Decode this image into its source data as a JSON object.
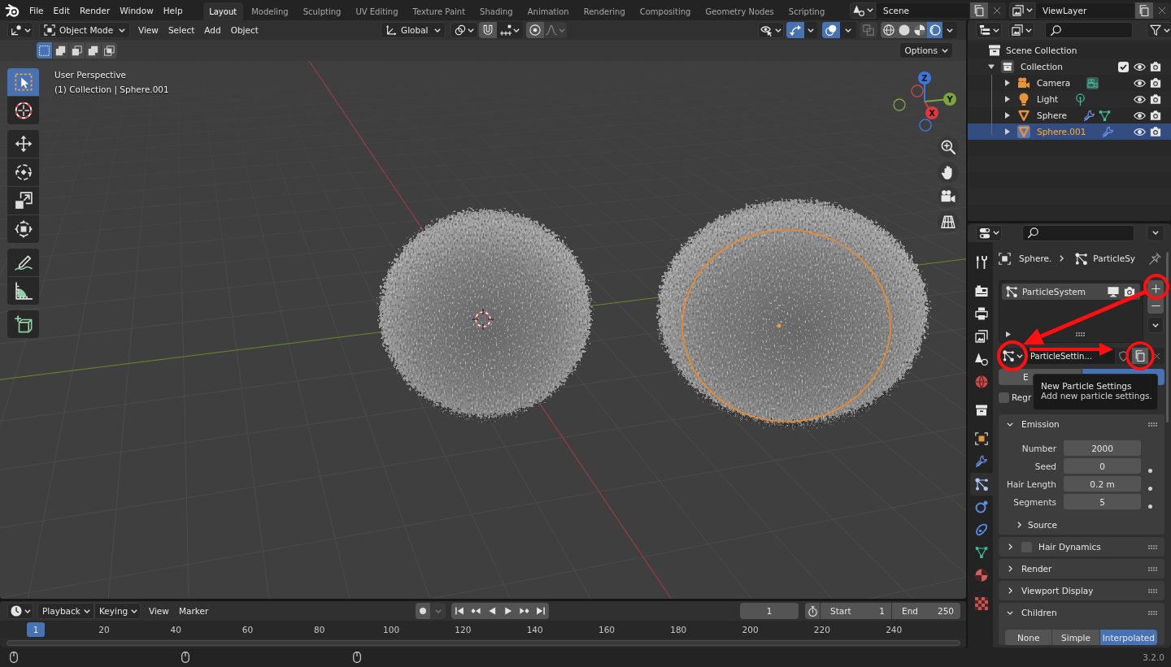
{
  "top_bar": {
    "menus": [
      "File",
      "Edit",
      "Render",
      "Window",
      "Help"
    ],
    "workspaces": [
      {
        "label": "Layout",
        "selected": true
      },
      {
        "label": "Modeling",
        "selected": false
      },
      {
        "label": "Sculpting",
        "selected": false
      },
      {
        "label": "UV Editing",
        "selected": false
      },
      {
        "label": "Texture Paint",
        "selected": false
      },
      {
        "label": "Shading",
        "selected": false
      },
      {
        "label": "Animation",
        "selected": false
      },
      {
        "label": "Rendering",
        "selected": false
      },
      {
        "label": "Compositing",
        "selected": false
      },
      {
        "label": "Geometry Nodes",
        "selected": false
      },
      {
        "label": "Scripting",
        "selected": false
      }
    ],
    "scene": "Scene",
    "view_layer": "ViewLayer"
  },
  "viewport": {
    "header": {
      "mode": "Object Mode",
      "menus": [
        "View",
        "Select",
        "Add",
        "Object"
      ],
      "orientation": "Global",
      "gizmos": {
        "on": true
      },
      "overlays": {
        "on": true
      },
      "xray": {
        "on": false
      },
      "shading": [
        {
          "selected": false
        },
        {
          "selected": false
        },
        {
          "selected": false
        },
        {
          "selected": true
        }
      ]
    },
    "tool_settings": {
      "select_modes": [
        {
          "selected": true
        },
        {
          "selected": false
        },
        {
          "selected": false
        },
        {
          "selected": false
        },
        {
          "selected": false
        }
      ],
      "options": "Options"
    },
    "info": [
      "User Perspective",
      "(1) Collection | Sphere.001"
    ],
    "toolbar": [
      [
        {
          "selected": true
        },
        {
          "selected": false
        }
      ],
      [
        {
          "selected": false
        },
        {
          "selected": false
        },
        {
          "selected": false
        },
        {
          "selected": false
        }
      ],
      [
        {
          "selected": false
        },
        {
          "selected": false
        }
      ],
      [
        {
          "selected": false
        }
      ]
    ],
    "gizmo_axes": [
      "X",
      "Y",
      "Z"
    ]
  },
  "outliner": {
    "tree": [
      {
        "label": "Scene Collection",
        "kind": "scene_collection",
        "selected": false,
        "children": [
          {
            "label": "Collection",
            "kind": "collection",
            "expanded": true,
            "checked": true,
            "selected": false,
            "children": [
              {
                "label": "Camera",
                "kind": "camera",
                "expanded": false,
                "selected": false,
                "extras": [
                  {
                    "kind": "camera_data"
                  }
                ]
              },
              {
                "label": "Light",
                "kind": "light",
                "expanded": false,
                "selected": false,
                "extras": [
                  {
                    "kind": "light_data"
                  }
                ]
              },
              {
                "label": "Sphere",
                "kind": "mesh",
                "expanded": false,
                "selected": false,
                "extras": [
                  {
                    "kind": "modifier"
                  },
                  {
                    "kind": "mesh_data"
                  }
                ]
              },
              {
                "label": "Sphere.001",
                "kind": "mesh",
                "expanded": false,
                "selected": true,
                "extras": [
                  {
                    "kind": "modifier"
                  }
                ]
              }
            ]
          }
        ]
      }
    ]
  },
  "properties": {
    "tabs": [
      [
        {
          "selected": false
        }
      ],
      [
        {
          "selected": false
        },
        {
          "selected": false
        },
        {
          "selected": false
        },
        {
          "selected": false
        },
        {
          "selected": false
        }
      ],
      [
        {
          "selected": false
        }
      ],
      [
        {
          "selected": false
        },
        {
          "selected": false
        },
        {
          "selected": true
        },
        {
          "selected": false
        },
        {
          "selected": false
        },
        {
          "selected": false
        },
        {
          "selected": false
        }
      ],
      [
        {
          "selected": false
        }
      ]
    ],
    "breadcrumb": [
      "Sphere.",
      "ParticleSy"
    ],
    "systems": [
      {
        "name": "ParticleSystem",
        "selected": true
      }
    ],
    "settings": "ParticleSettin...",
    "types": [
      {
        "label": "E",
        "selected": false
      },
      {
        "selected": true
      }
    ],
    "tooltip": {
      "title": "New Particle Settings",
      "text": "Add new particle settings."
    },
    "regrow": {
      "label": "Regr",
      "checked": false
    },
    "panels": [
      {
        "title": "Emission",
        "expanded": true,
        "fields": [
          {
            "label": "Number",
            "value": "2000",
            "keyframe_dot": false
          },
          {
            "label": "Seed",
            "value": "0",
            "keyframe_dot": true
          },
          {
            "label": "Hair Length",
            "value": "0.2 m",
            "keyframe_dot": true
          },
          {
            "label": "Segments",
            "value": "5",
            "keyframe_dot": true
          }
        ],
        "subpanels": [
          {
            "title": "Source",
            "expanded": false
          }
        ]
      },
      {
        "title": "Hair Dynamics",
        "expanded": false,
        "checked": false
      },
      {
        "title": "Render",
        "expanded": false
      },
      {
        "title": "Viewport Display",
        "expanded": false
      },
      {
        "title": "Children",
        "expanded": true,
        "options": [
          {
            "label": "None",
            "selected": false
          },
          {
            "label": "Simple",
            "selected": false
          },
          {
            "label": "Interpolated",
            "selected": true
          }
        ]
      }
    ]
  },
  "timeline": {
    "menus": [
      {
        "label": "Playback",
        "kind": "dropdown"
      },
      {
        "label": "Keying",
        "kind": "dropdown"
      },
      {
        "label": "View",
        "kind": "menu"
      },
      {
        "label": "Marker",
        "kind": "menu"
      }
    ],
    "current_frame": "1",
    "start": {
      "label": "Start",
      "value": "1"
    },
    "end": {
      "label": "End",
      "value": "250"
    },
    "playhead": "1",
    "ruler": [
      "20",
      "40",
      "60",
      "80",
      "100",
      "120",
      "140",
      "160",
      "180",
      "200",
      "220",
      "240"
    ]
  },
  "status_bar": {
    "version": "3.2.0"
  }
}
